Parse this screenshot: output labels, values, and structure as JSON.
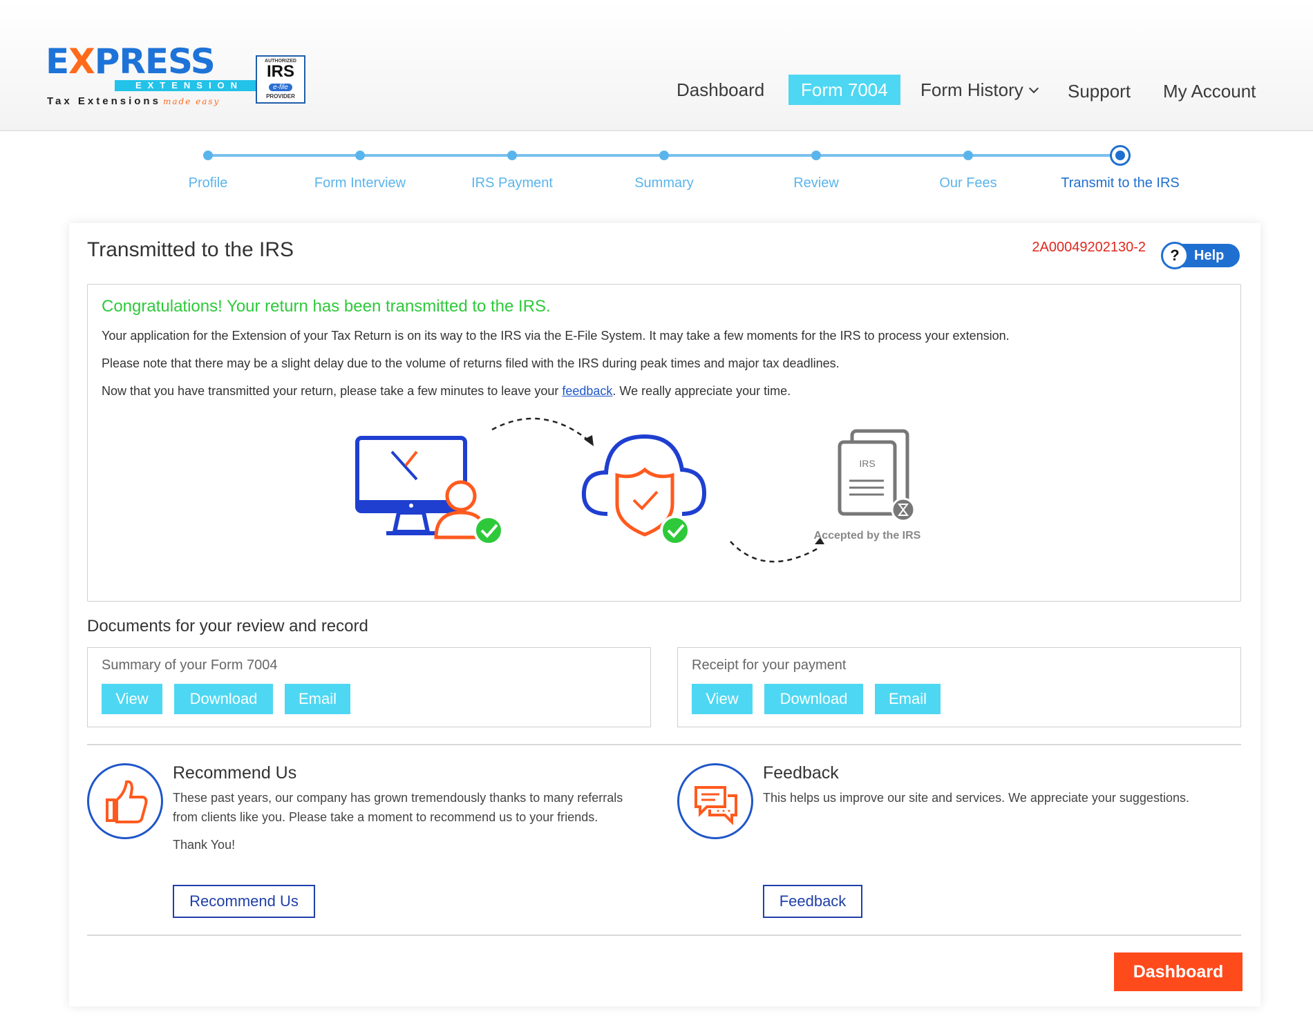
{
  "brand": {
    "logo_word_pre": "E",
    "logo_word_x": "X",
    "logo_word_post": "PRESS",
    "logo_bar": "EXTENSION",
    "logo_tag": "Tax Extensions",
    "logo_sub": "made easy",
    "irs_top": "AUTHORIZED",
    "irs_main": "IRS",
    "irs_efile": "e-file",
    "irs_provider": "PROVIDER"
  },
  "nav": {
    "dashboard": "Dashboard",
    "form7004": "Form 7004",
    "form_history": "Form History",
    "support": "Support",
    "my_account": "My Account"
  },
  "steps": [
    "Profile",
    "Form Interview",
    "IRS Payment",
    "Summary",
    "Review",
    "Our Fees",
    "Transmit to the IRS"
  ],
  "card": {
    "title": "Transmitted to the IRS",
    "reference": "2A00049202130-2",
    "help_label": "Help",
    "help_symbol": "?"
  },
  "message": {
    "title": "Congratulations! Your return has been transmitted to the IRS.",
    "line1": "Your application for the Extension of your Tax Return is on its way to the IRS via the E-File System. It may take a few moments for the IRS to process your extension.",
    "line2": "Please note that there may be a slight delay due to the volume of returns filed with the IRS during peak times and major tax deadlines.",
    "line3_pre": "Now that you have transmitted your return, please take a few minutes to leave your ",
    "line3_link": "feedback",
    "line3_post": ". We really appreciate your time.",
    "illus_doc_label": "IRS",
    "illus_caption": "Accepted by the IRS"
  },
  "documents": {
    "title": "Documents for your review and record",
    "summary_label": "Summary of your Form 7004",
    "receipt_label": "Receipt for your payment",
    "view": "View",
    "download": "Download",
    "email": "Email"
  },
  "recommend": {
    "title": "Recommend Us",
    "text1": "These past years, our company has grown tremendously thanks to many referrals",
    "text2": "from clients like you. Please take a moment to recommend us to your friends.",
    "thanks": "Thank You!",
    "button": "Recommend Us"
  },
  "feedback": {
    "title": "Feedback",
    "text": "This helps us improve our site and services. We appreciate your suggestions.",
    "button": "Feedback"
  },
  "footer": {
    "dashboard_button": "Dashboard"
  },
  "colors": {
    "accent_cyan": "#4ed7f2",
    "brand_blue": "#1f6fd0",
    "success_green": "#2ec93a",
    "alert_orange": "#ff4a1c",
    "reference_red": "#e0261c"
  }
}
